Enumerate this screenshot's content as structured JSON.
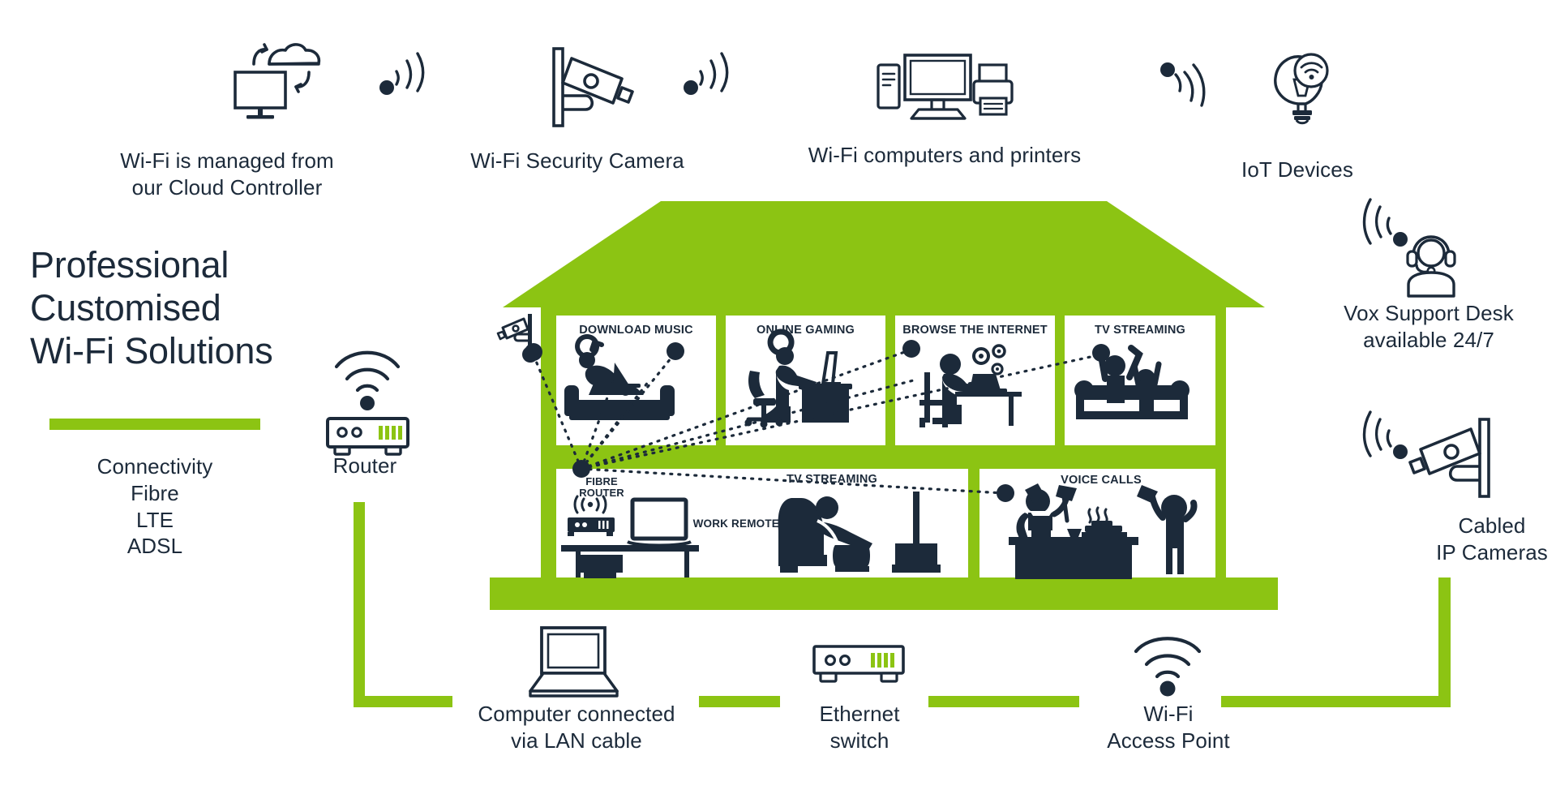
{
  "theme": {
    "green": "#8cc413",
    "navy": "#1c2a3a",
    "background": "#ffffff"
  },
  "headline": {
    "line1": "Professional Customised",
    "line2": "Wi-Fi Solutions"
  },
  "connectivity": {
    "heading": "Connectivity",
    "options": [
      "Fibre",
      "LTE",
      "ADSL"
    ]
  },
  "top_items": [
    {
      "id": "cloud-controller",
      "icon": "cloud-monitor-icon",
      "label_line1": "Wi-Fi is managed from",
      "label_line2": "our Cloud Controller"
    },
    {
      "id": "security-camera",
      "icon": "security-camera-icon",
      "label_line1": "Wi-Fi Security Camera",
      "label_line2": ""
    },
    {
      "id": "computers-printers",
      "icon": "desktop-printer-icon",
      "label_line1": "Wi-Fi computers and printers",
      "label_line2": ""
    },
    {
      "id": "iot-devices",
      "icon": "lightbulb-wifi-icon",
      "label_line1": "IoT Devices",
      "label_line2": ""
    }
  ],
  "right_items": [
    {
      "id": "support-desk",
      "icon": "headset-agent-icon",
      "label_line1": "Vox Support Desk",
      "label_line2": "available 24/7"
    },
    {
      "id": "cabled-ip-cameras",
      "icon": "security-camera-icon",
      "label_line1": "Cabled",
      "label_line2": "IP Cameras"
    }
  ],
  "router": {
    "icon": "router-wifi-icon",
    "label": "Router"
  },
  "bottom_items": [
    {
      "id": "lan-computer",
      "icon": "laptop-icon",
      "label_line1": "Computer connected",
      "label_line2": "via LAN cable"
    },
    {
      "id": "ethernet-switch",
      "icon": "switch-icon",
      "label_line1": "Ethernet",
      "label_line2": "switch"
    },
    {
      "id": "access-point",
      "icon": "wifi-signal-icon",
      "label_line1": "Wi-Fi",
      "label_line2": "Access Point"
    }
  ],
  "house": {
    "upper_rooms": [
      {
        "id": "download-music",
        "label": "DOWNLOAD MUSIC"
      },
      {
        "id": "online-gaming",
        "label": "ONLINE GAMING"
      },
      {
        "id": "browse-internet",
        "label": "BROWSE THE INTERNET"
      },
      {
        "id": "tv-streaming-upper",
        "label": "TV STREAMING"
      }
    ],
    "lower_room_labels": {
      "fibre_router": "FIBRE\nROUTER",
      "work_remotely": "WORK REMOTELY",
      "tv_streaming": "TV STREAMING",
      "voice_calls": "VOICE CALLS"
    }
  }
}
